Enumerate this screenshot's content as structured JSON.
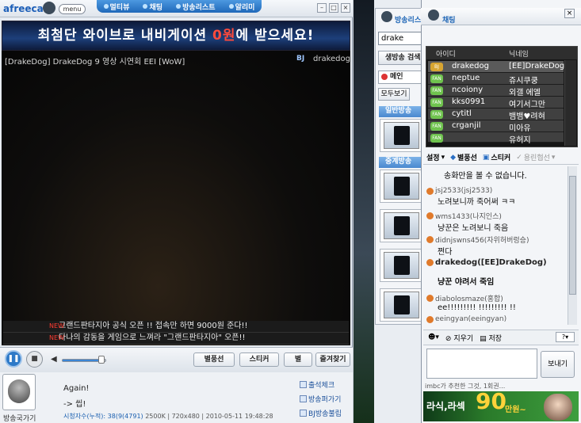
{
  "player": {
    "logo": "afreeca",
    "menu_label": "menu",
    "nav": [
      "멀티뷰",
      "채팅",
      "방송리스트",
      "알리미"
    ],
    "banner": {
      "text": "최첨단 와이브로 내비게이션 ",
      "highlight": "0원",
      "suffix": "에 받으세요!"
    },
    "video_title": "[DrakeDog] DrakeDog 9 영상 시연회 EEI [WoW]",
    "bj_label": "BJ",
    "bj_name": "drakedog",
    "ticker": [
      "그랜드판타지아 공식 오픈 !! 접속만 하면 9000원 준다!!",
      "다나의 감동을 게임으로 느껴라 \"그랜드판타지아\" 오픈!!"
    ],
    "ticker_badge": "NEW",
    "buttons": {
      "balloon": "별풍선",
      "sticker": "스티커",
      "star": "별",
      "favorite": "즐겨찾기"
    },
    "broadcast_label": "방송국가기",
    "note_line1": "Again!",
    "note_line2": "-> 씹!",
    "stats": {
      "label": "시청자수(누적):",
      "viewers": "38(9(4791)",
      "bitrate": "2500K",
      "resolution": "720x480",
      "datetime": "2010-05-11 19:48:28"
    },
    "side_links": [
      "출석체크",
      "방송퍼가기",
      "BJ방송불립"
    ]
  },
  "list": {
    "title": "방송리스트",
    "search_value": "drake",
    "search_button": "생방송 검색",
    "tab_main": "메인",
    "all_button": "모두보기",
    "section1": "일반방송",
    "section2": "중계방송"
  },
  "chat": {
    "title": "채팅",
    "col_id": "아이디",
    "col_nick": "닉네임",
    "users": [
      {
        "id": "drakedog",
        "nick": "[EE]DrakeDog"
      },
      {
        "id": "neptue",
        "nick": "쥬시쿠쿵"
      },
      {
        "id": "ncoiony",
        "nick": "외갤 에엘"
      },
      {
        "id": "kks0991",
        "nick": "여기서그만"
      },
      {
        "id": "cytitl",
        "nick": "뱀뱀♥려혀"
      },
      {
        "id": "crganjil",
        "nick": "미아유"
      },
      {
        "id": "",
        "nick": "유허지"
      }
    ],
    "tools": {
      "settings": "설정",
      "balloon": "별풍선",
      "sticker": "스티커",
      "invite": "용린협선"
    },
    "log_notice": "송화만을 볼 수 없습니다.",
    "messages": [
      {
        "who": "jsj2533(jsj2533)",
        "text": "노려보니까 죽어써 ㅋㅋ"
      },
      {
        "who": "wms1433(나지인스)",
        "text": "냥꾼은 노려보니 죽음"
      },
      {
        "who": "didnjswns456(자위허버렁승)",
        "text": "쩐다"
      },
      {
        "who": "drakedog([EE]DrakeDog)",
        "text": "냥꾼 야려서 죽임"
      },
      {
        "who": "diabolosmaze(홍합)",
        "text": "ee!!!!!!!!! !!!!!!!!! !!"
      },
      {
        "who": "eeingyan(eeingyan)",
        "text": ""
      }
    ],
    "bar": {
      "erase": "지우기",
      "save": "저장",
      "help": "?"
    },
    "send": "보내기",
    "recommend": "imbc가 추천한 그것, 1회권...",
    "ad": {
      "text": "라식,라섹",
      "number": "90",
      "unit": "만원~"
    }
  }
}
